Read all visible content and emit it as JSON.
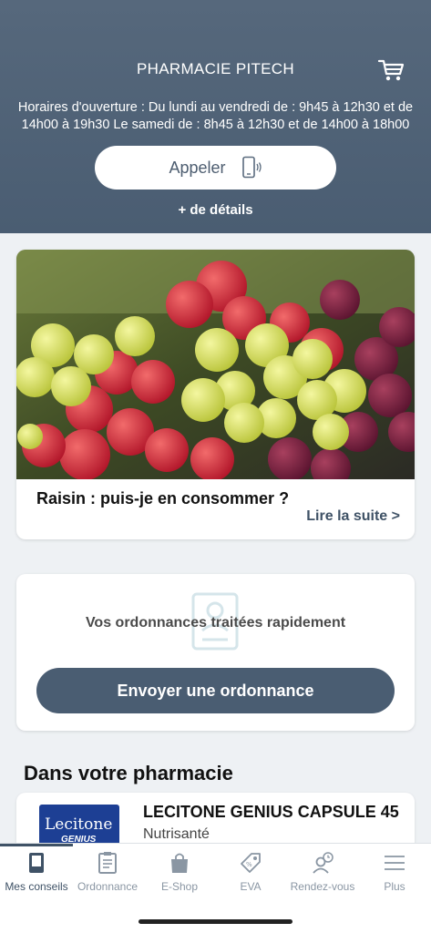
{
  "header": {
    "pharmacy_name": "PHARMACIE PITECH",
    "hours_line1": "Horaires d'ouverture : Du lundi au vendredi de : 9h45 à 12h30 et de",
    "hours_line2": "14h00 à 19h30 Le samedi de : 8h45 à 12h30 et de 14h00 à 18h00",
    "call_label": "Appeler",
    "details_label": "+ de détails"
  },
  "article": {
    "title": "Raisin : puis-je en consommer ?",
    "more_label": "Lire la suite >"
  },
  "prescription": {
    "text": "Vos ordonnances traitées rapidement",
    "button_label": "Envoyer une ordonnance"
  },
  "section": {
    "title": "Dans votre pharmacie"
  },
  "product": {
    "name": "LECITONE GENIUS CAPSULE 45",
    "brand": "Nutrisanté",
    "box_text_1": "Lecitone",
    "box_text_2": "GENIUS"
  },
  "tabs": [
    {
      "label": "Mes conseils",
      "icon": "tablet-icon",
      "active": true
    },
    {
      "label": "Ordonnance",
      "icon": "clipboard-icon"
    },
    {
      "label": "E-Shop",
      "icon": "bag-icon"
    },
    {
      "label": "EVA",
      "icon": "tag-icon"
    },
    {
      "label": "Rendez-vous",
      "icon": "user-clock-icon"
    },
    {
      "label": "Plus",
      "icon": "menu-icon"
    }
  ],
  "colors": {
    "header": "#4a5d72",
    "accent": "#3f5266",
    "background": "#eef1f4"
  }
}
